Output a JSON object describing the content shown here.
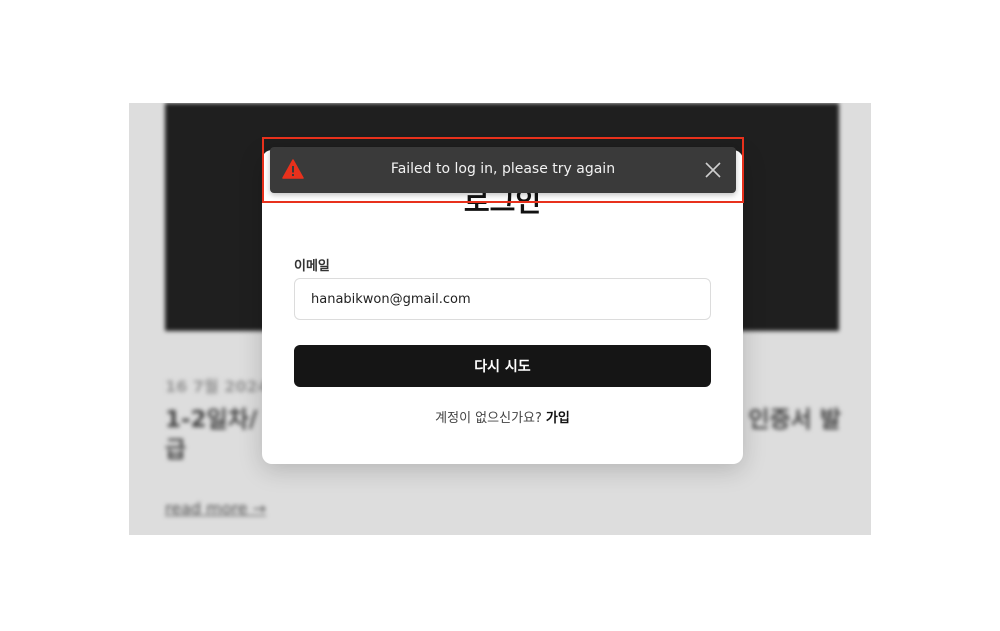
{
  "background": {
    "date": "16 7월 2024",
    "title_left": "1-2일차/",
    "title_right": "인증서 발",
    "title_second_line": "급",
    "read_more": "read more →"
  },
  "toast": {
    "message": "Failed to log in, please try again",
    "icon": "warning-icon",
    "close_icon": "close-icon",
    "icon_color": "#e8311c",
    "highlight_color": "#e8311c"
  },
  "login_modal": {
    "title": "로그인",
    "email_label": "이메일",
    "email_value": "hanabikwon@gmail.com",
    "retry_button_label": "다시 시도",
    "no_account_text": "계정이 없으신가요?",
    "signup_link": "가입"
  }
}
